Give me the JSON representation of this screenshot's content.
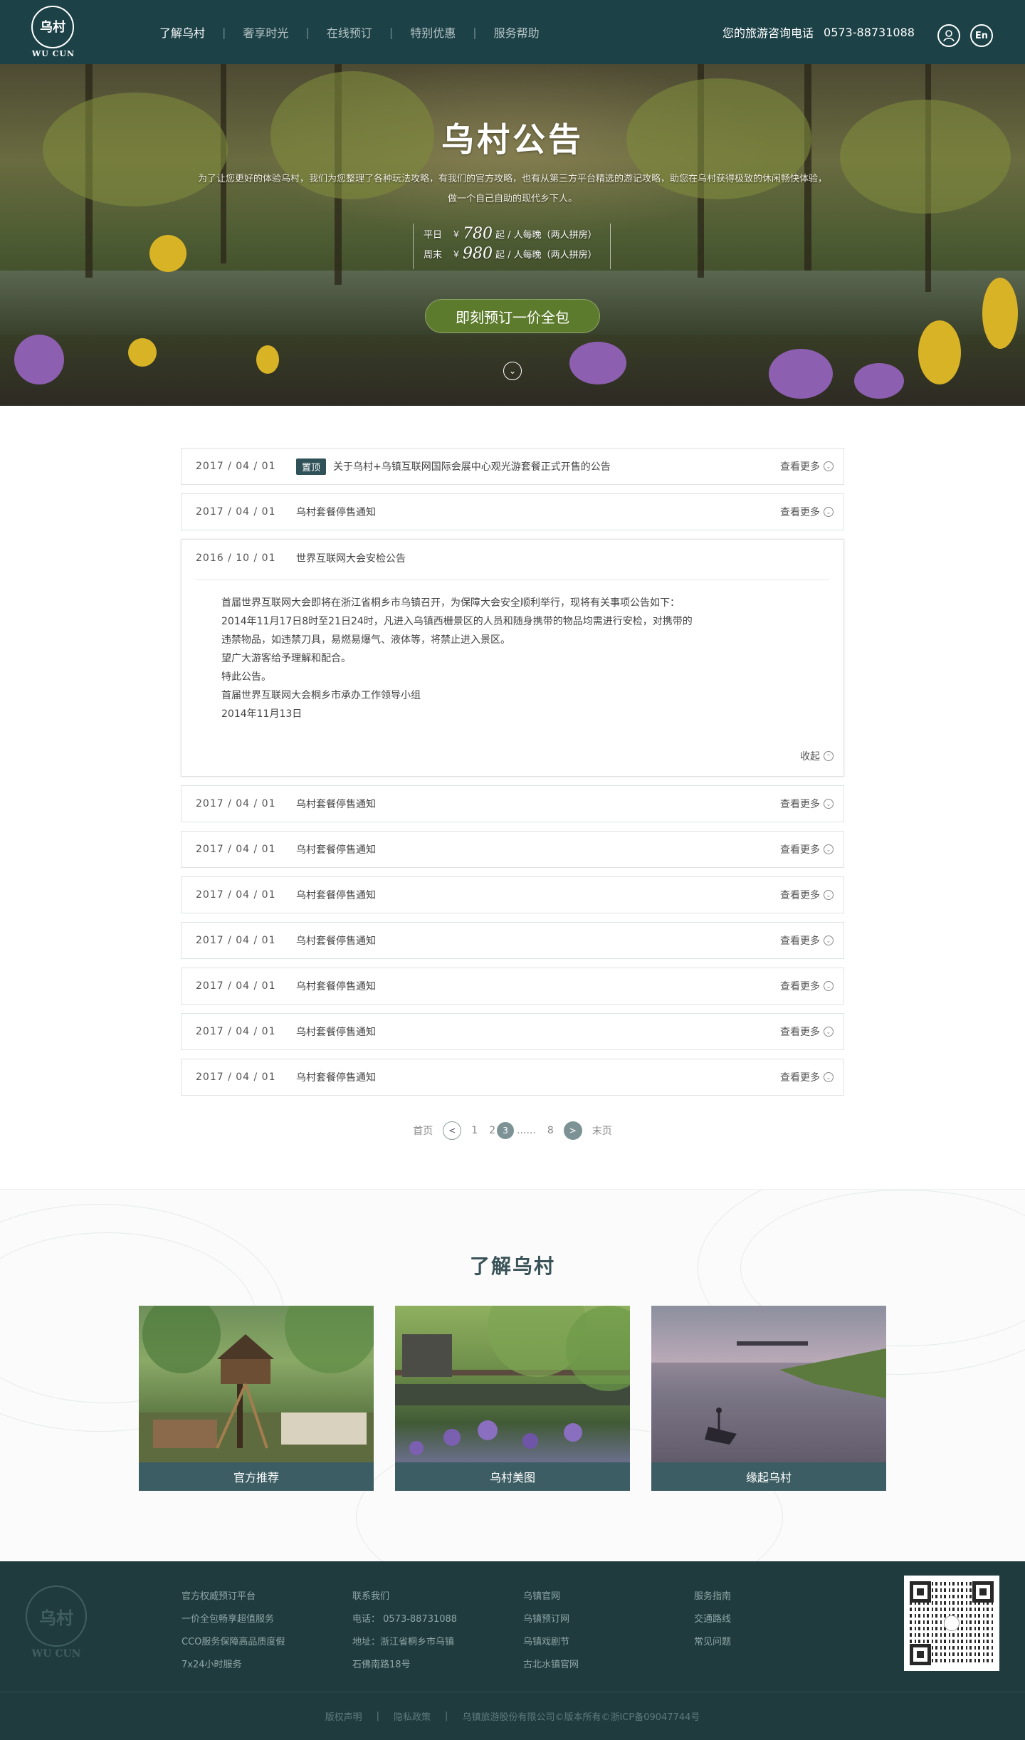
{
  "header": {
    "logo_text": "WU CUN",
    "logo_glyph": "乌村",
    "nav": [
      {
        "label": "了解乌村",
        "active": true
      },
      {
        "label": "奢享时光"
      },
      {
        "label": "在线预订"
      },
      {
        "label": "特别优惠"
      },
      {
        "label": "服务帮助"
      }
    ],
    "hotline_label": "您的旅游咨询电话",
    "hotline_number": "0573-88731088",
    "user_icon": "user-icon",
    "lang_label": "En"
  },
  "hero": {
    "title": "乌村公告",
    "desc_line1": "为了让您更好的体验乌村，我们为您整理了各种玩法攻略，有我们的官方攻略，也有从第三方平台精选的游记攻略，助您在乌村获得极致的休闲畅快体验，",
    "desc_line2": "做一个自己自助的现代乡下人。",
    "weekday_label": "平日",
    "weekday_currency": "￥",
    "weekday_price": "780",
    "weekday_suffix": "起 / 人每晚（两人拼房）",
    "weekend_label": "周末",
    "weekend_currency": "￥",
    "weekend_price": "980",
    "weekend_suffix": "起 / 人每晚（两人拼房）",
    "book_button": "即刻预订一价全包",
    "scroll_icon": "chevron-down-icon"
  },
  "notices": {
    "top_badge": "置顶",
    "more_label": "查看更多",
    "collapse_label": "收起",
    "rows_before": [
      {
        "date": "2017 / 04 / 01",
        "title": "关于乌村+乌镇互联网国际会展中心观光游套餐正式开售的公告",
        "pinned": true
      },
      {
        "date": "2017 / 04 / 01",
        "title": "乌村套餐停售通知"
      }
    ],
    "open": {
      "date": "2016 / 10 / 01",
      "title": "世界互联网大会安检公告",
      "line1": "首届世界互联网大会即将在浙江省桐乡市乌镇召开，为保障大会安全顺利举行，现将有关事项公告如下：",
      "line2": "2014年11月17日8时至21日24时，凡进入乌镇西栅景区的人员和随身携带的物品均需进行安检，对携带的",
      "line3": "违禁物品，如违禁刀具，易燃易爆气、液体等，将禁止进入景区。",
      "line4": "望广大游客给予理解和配合。",
      "line5": "特此公告。",
      "line6": "首届世界互联网大会桐乡市承办工作领导小组",
      "line7": "2014年11月13日"
    },
    "rows_after": [
      {
        "date": "2017 / 04 / 01",
        "title": "乌村套餐停售通知"
      },
      {
        "date": "2017 / 04 / 01",
        "title": "乌村套餐停售通知"
      },
      {
        "date": "2017 / 04 / 01",
        "title": "乌村套餐停售通知"
      },
      {
        "date": "2017 / 04 / 01",
        "title": "乌村套餐停售通知"
      },
      {
        "date": "2017 / 04 / 01",
        "title": "乌村套餐停售通知"
      },
      {
        "date": "2017 / 04 / 01",
        "title": "乌村套餐停售通知"
      },
      {
        "date": "2017 / 04 / 01",
        "title": "乌村套餐停售通知"
      }
    ]
  },
  "pagination": {
    "first": "首页",
    "pages": [
      "1",
      "2"
    ],
    "current": "3",
    "ellipsis": "......",
    "last_page": "8",
    "last": "末页"
  },
  "about": {
    "title": "了解乌村",
    "cards": [
      {
        "caption": "官方推荐"
      },
      {
        "caption": "乌村美图"
      },
      {
        "caption": "缘起乌村"
      }
    ]
  },
  "footer": {
    "logo_text": "WU CUN",
    "logo_glyph": "乌村",
    "col1": [
      "官方权威预订平台",
      "一价全包畅享超值服务",
      "CCO服务保障高品质度假",
      "7x24小时服务"
    ],
    "col2": [
      "联系我们",
      "电话： 0573-88731088",
      "地址：浙江省桐乡市乌镇",
      "石佛南路18号"
    ],
    "col3": [
      "乌镇官网",
      "乌镇预订网",
      "乌镇戏剧节",
      "古北水镇官网"
    ],
    "col4": [
      "服务指南",
      "交通路线",
      "常见问题"
    ],
    "copyright": [
      "版权声明",
      "隐私政策",
      "乌镇旅游股份有限公司©版本所有©浙ICP备09047744号"
    ]
  }
}
